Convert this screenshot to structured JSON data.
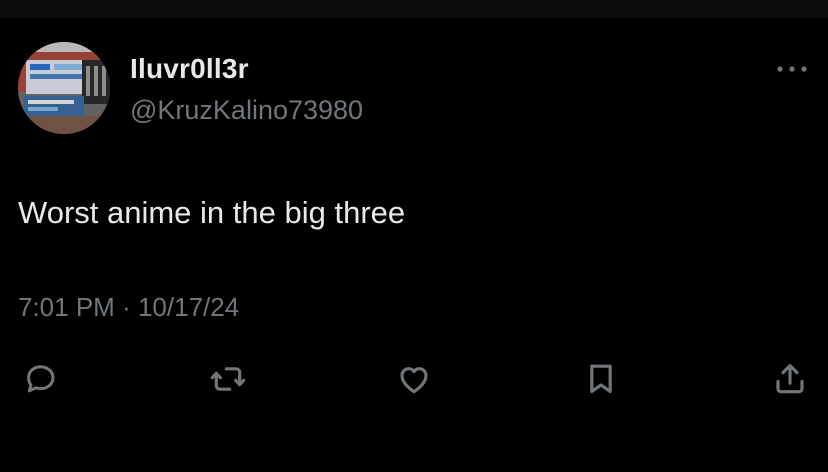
{
  "tweet": {
    "display_name": "Iluvr0ll3r",
    "handle": "@KruzKalino73980",
    "text": "Worst anime in the big three",
    "time": "7:01 PM",
    "separator": "·",
    "date": "10/17/24"
  },
  "icons": {
    "more": "more-dots-icon",
    "reply": "reply-bubble-icon",
    "retweet": "retweet-icon",
    "like": "heart-icon",
    "bookmark": "bookmark-icon",
    "share": "share-upload-icon"
  },
  "colors": {
    "background": "#000000",
    "primary_text": "#e7e9ea",
    "secondary_text": "#71767b"
  }
}
